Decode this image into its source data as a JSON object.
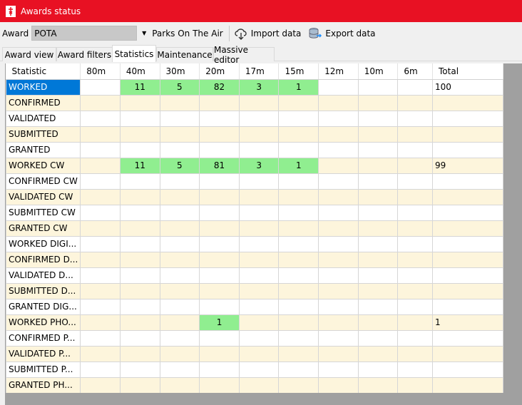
{
  "window": {
    "title": "Awards status"
  },
  "toolbar": {
    "award_label": "Award",
    "award_value": "POTA",
    "award_name": "Parks On The Air",
    "import_label": "Import data",
    "export_label": "Export data"
  },
  "tabs": [
    {
      "label": "Award view",
      "active": false
    },
    {
      "label": "Award filters",
      "active": false
    },
    {
      "label": "Statistics",
      "active": true
    },
    {
      "label": "Maintenance",
      "active": false
    },
    {
      "label": "Massive editor",
      "active": false
    }
  ],
  "colors": {
    "titlebar": "#e81123",
    "selected_cell": "#0078d7",
    "highlight_cell": "#90ee90",
    "alt_row": "#fdf5dc"
  },
  "grid": {
    "columns": [
      "Statistic",
      "80m",
      "40m",
      "30m",
      "20m",
      "17m",
      "15m",
      "12m",
      "10m",
      "6m",
      "Total"
    ],
    "rows": [
      {
        "label": "WORKED",
        "cells": [
          "",
          "11",
          "5",
          "82",
          "3",
          "1",
          "",
          "",
          ""
        ],
        "total": "100"
      },
      {
        "label": "CONFIRMED",
        "cells": [
          "",
          "",
          "",
          "",
          "",
          "",
          "",
          "",
          ""
        ],
        "total": ""
      },
      {
        "label": "VALIDATED",
        "cells": [
          "",
          "",
          "",
          "",
          "",
          "",
          "",
          "",
          ""
        ],
        "total": ""
      },
      {
        "label": "SUBMITTED",
        "cells": [
          "",
          "",
          "",
          "",
          "",
          "",
          "",
          "",
          ""
        ],
        "total": ""
      },
      {
        "label": "GRANTED",
        "cells": [
          "",
          "",
          "",
          "",
          "",
          "",
          "",
          "",
          ""
        ],
        "total": ""
      },
      {
        "label": "WORKED CW",
        "cells": [
          "",
          "11",
          "5",
          "81",
          "3",
          "1",
          "",
          "",
          ""
        ],
        "total": "99"
      },
      {
        "label": "CONFIRMED CW",
        "cells": [
          "",
          "",
          "",
          "",
          "",
          "",
          "",
          "",
          ""
        ],
        "total": ""
      },
      {
        "label": "VALIDATED CW",
        "cells": [
          "",
          "",
          "",
          "",
          "",
          "",
          "",
          "",
          ""
        ],
        "total": ""
      },
      {
        "label": "SUBMITTED CW",
        "cells": [
          "",
          "",
          "",
          "",
          "",
          "",
          "",
          "",
          ""
        ],
        "total": ""
      },
      {
        "label": "GRANTED CW",
        "cells": [
          "",
          "",
          "",
          "",
          "",
          "",
          "",
          "",
          ""
        ],
        "total": ""
      },
      {
        "label": "WORKED DIGI...",
        "cells": [
          "",
          "",
          "",
          "",
          "",
          "",
          "",
          "",
          ""
        ],
        "total": ""
      },
      {
        "label": "CONFIRMED D...",
        "cells": [
          "",
          "",
          "",
          "",
          "",
          "",
          "",
          "",
          ""
        ],
        "total": ""
      },
      {
        "label": "VALIDATED D...",
        "cells": [
          "",
          "",
          "",
          "",
          "",
          "",
          "",
          "",
          ""
        ],
        "total": ""
      },
      {
        "label": "SUBMITTED D...",
        "cells": [
          "",
          "",
          "",
          "",
          "",
          "",
          "",
          "",
          ""
        ],
        "total": ""
      },
      {
        "label": "GRANTED DIG...",
        "cells": [
          "",
          "",
          "",
          "",
          "",
          "",
          "",
          "",
          ""
        ],
        "total": ""
      },
      {
        "label": "WORKED PHO...",
        "cells": [
          "",
          "",
          "",
          "1",
          "",
          "",
          "",
          "",
          ""
        ],
        "total": "1"
      },
      {
        "label": "CONFIRMED P...",
        "cells": [
          "",
          "",
          "",
          "",
          "",
          "",
          "",
          "",
          ""
        ],
        "total": ""
      },
      {
        "label": "VALIDATED P...",
        "cells": [
          "",
          "",
          "",
          "",
          "",
          "",
          "",
          "",
          ""
        ],
        "total": ""
      },
      {
        "label": "SUBMITTED P...",
        "cells": [
          "",
          "",
          "",
          "",
          "",
          "",
          "",
          "",
          ""
        ],
        "total": ""
      },
      {
        "label": "GRANTED PH...",
        "cells": [
          "",
          "",
          "",
          "",
          "",
          "",
          "",
          "",
          ""
        ],
        "total": ""
      }
    ]
  }
}
